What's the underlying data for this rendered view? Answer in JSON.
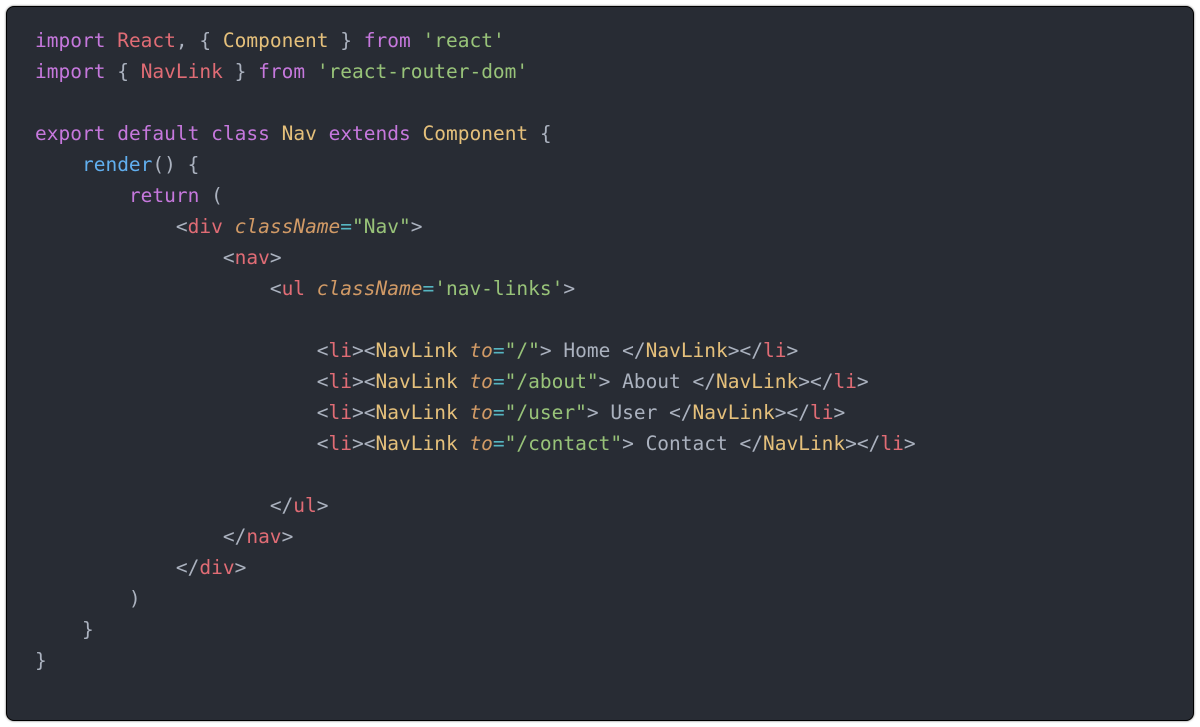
{
  "imports": {
    "kw_import": "import",
    "kw_from": "from",
    "react_default": "React",
    "component": "Component",
    "react_pkg": "'react'",
    "navlink": "NavLink",
    "router_pkg": "'react-router-dom'"
  },
  "cls": {
    "kw_export": "export",
    "kw_default": "default",
    "kw_class": "class",
    "name": "Nav",
    "kw_extends": "extends",
    "super": "Component"
  },
  "method": {
    "name": "render",
    "kw_return": "return"
  },
  "jsx": {
    "div": "div",
    "nav": "nav",
    "ul": "ul",
    "li": "li",
    "navlink": "NavLink",
    "attr_className": "className",
    "attr_to": "to",
    "val_nav": "\"Nav\"",
    "val_navlinks": "'nav-links'",
    "links": [
      {
        "to": "\"/\"",
        "text": " Home "
      },
      {
        "to": "\"/about\"",
        "text": " About "
      },
      {
        "to": "\"/user\"",
        "text": " User "
      },
      {
        "to": "\"/contact\"",
        "text": " Contact "
      }
    ]
  }
}
